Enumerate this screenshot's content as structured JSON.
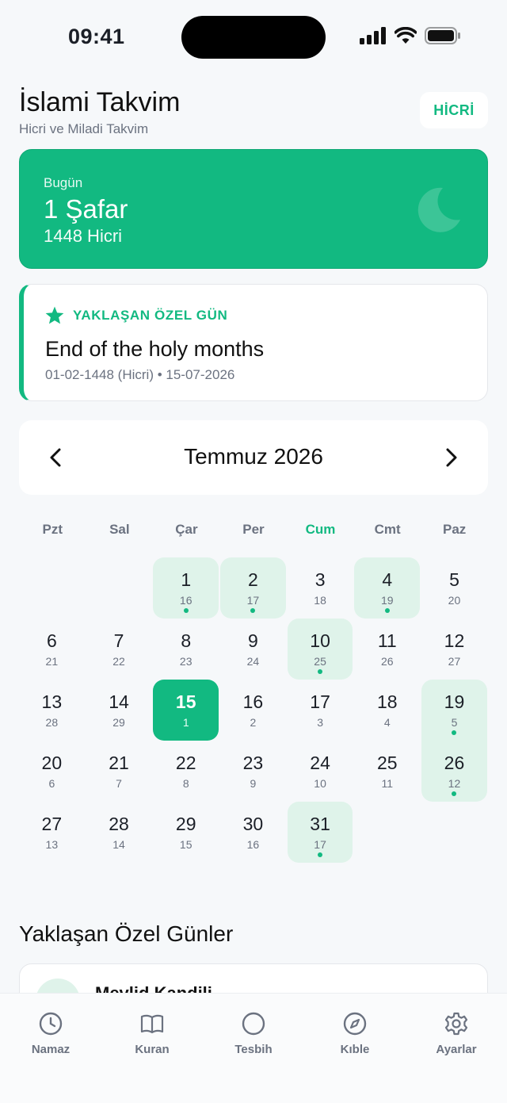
{
  "status_bar": {
    "time": "09:41"
  },
  "header": {
    "title": "İslami Takvim",
    "subtitle": "Hicri ve Miladi Takvim",
    "toggle_label": "HİCRİ"
  },
  "today_card": {
    "label": "Bugün",
    "date": "1 Şafar",
    "year": "1448 Hicri",
    "icon": "moon-icon"
  },
  "special_card": {
    "label": "YAKLAŞAN ÖZEL GÜN",
    "title": "End of the holy months",
    "dates": "01-02-1448 (Hicri) • 15-07-2026",
    "icon": "star-icon"
  },
  "calendar": {
    "month_title": "Temmuz 2026",
    "weekdays": [
      "Pzt",
      "Sal",
      "Çar",
      "Per",
      "Cum",
      "Cmt",
      "Paz"
    ],
    "active_weekday": "Cum",
    "leading_empty": 2,
    "days": [
      {
        "d": "1",
        "h": "16",
        "event": true
      },
      {
        "d": "2",
        "h": "17",
        "event": true
      },
      {
        "d": "3",
        "h": "18",
        "event": false
      },
      {
        "d": "4",
        "h": "19",
        "event": true
      },
      {
        "d": "5",
        "h": "20",
        "event": false
      },
      {
        "d": "6",
        "h": "21",
        "event": false
      },
      {
        "d": "7",
        "h": "22",
        "event": false
      },
      {
        "d": "8",
        "h": "23",
        "event": false
      },
      {
        "d": "9",
        "h": "24",
        "event": false
      },
      {
        "d": "10",
        "h": "25",
        "event": true
      },
      {
        "d": "11",
        "h": "26",
        "event": false
      },
      {
        "d": "12",
        "h": "27",
        "event": false
      },
      {
        "d": "13",
        "h": "28",
        "event": false
      },
      {
        "d": "14",
        "h": "29",
        "event": false
      },
      {
        "d": "15",
        "h": "1",
        "event": false,
        "today": true
      },
      {
        "d": "16",
        "h": "2",
        "event": false
      },
      {
        "d": "17",
        "h": "3",
        "event": false
      },
      {
        "d": "18",
        "h": "4",
        "event": false
      },
      {
        "d": "19",
        "h": "5",
        "event": true
      },
      {
        "d": "20",
        "h": "6",
        "event": false
      },
      {
        "d": "21",
        "h": "7",
        "event": false
      },
      {
        "d": "22",
        "h": "8",
        "event": false
      },
      {
        "d": "23",
        "h": "9",
        "event": false
      },
      {
        "d": "24",
        "h": "10",
        "event": false
      },
      {
        "d": "25",
        "h": "11",
        "event": false
      },
      {
        "d": "26",
        "h": "12",
        "event": true
      },
      {
        "d": "27",
        "h": "13",
        "event": false
      },
      {
        "d": "28",
        "h": "14",
        "event": false
      },
      {
        "d": "29",
        "h": "15",
        "event": false
      },
      {
        "d": "30",
        "h": "16",
        "event": false
      },
      {
        "d": "31",
        "h": "17",
        "event": true
      }
    ]
  },
  "upcoming": {
    "section_title": "Yaklaşan Özel Günler",
    "first_item": "Mevlid Kandili"
  },
  "tabs": [
    {
      "label": "Namaz",
      "icon": "clock-icon"
    },
    {
      "label": "Kuran",
      "icon": "book-icon"
    },
    {
      "label": "Tesbih",
      "icon": "circle-icon"
    },
    {
      "label": "Kıble",
      "icon": "compass-icon"
    },
    {
      "label": "Ayarlar",
      "icon": "gear-icon"
    }
  ],
  "colors": {
    "accent": "#12b981",
    "event_bg": "#dff3ea",
    "muted": "#6b7280"
  }
}
